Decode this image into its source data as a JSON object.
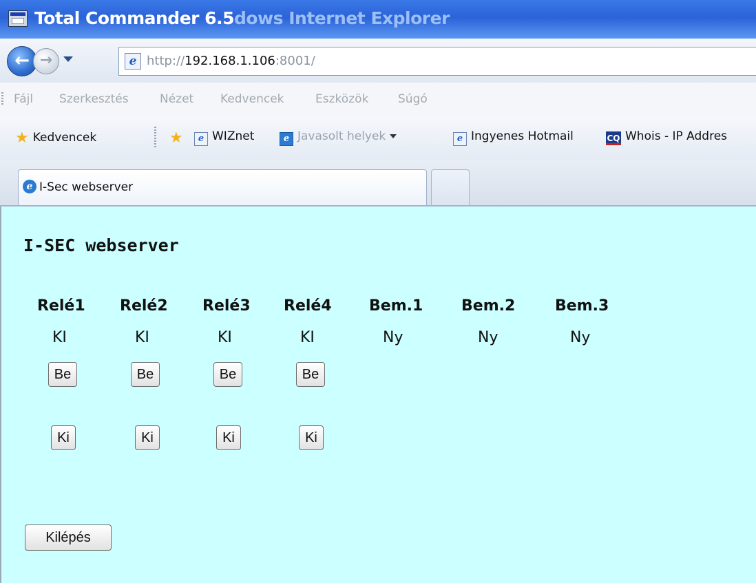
{
  "window": {
    "title_visible": "Total Commander 6.5",
    "title_ghost": "dows Internet Explorer"
  },
  "address": {
    "scheme": "http://",
    "host": "192.168.1.106",
    "rest": ":8001/"
  },
  "menu": {
    "items": [
      "Fájl",
      "Szerkesztés",
      "Nézet",
      "Kedvencek",
      "Eszközök",
      "Súgó"
    ]
  },
  "favorites": {
    "label": "Kedvencek",
    "items": [
      {
        "label": "WIZnet",
        "icon": "ie-page-icon"
      },
      {
        "label": "Javasolt helyek",
        "icon": "ie-logo-icon"
      },
      {
        "label": "Ingyenes Hotmail",
        "icon": "ie-page-icon"
      },
      {
        "label": "Whois - IP Addres",
        "icon": "cq-logo-icon"
      }
    ]
  },
  "tabs": [
    {
      "label": "I-Sec webserver",
      "active": true
    }
  ],
  "page": {
    "title": "I-SEC webserver",
    "columns": [
      {
        "label": "Relé1",
        "state": "KI",
        "on_button": "Be",
        "off_button": "Ki"
      },
      {
        "label": "Relé2",
        "state": "KI",
        "on_button": "Be",
        "off_button": "Ki"
      },
      {
        "label": "Relé3",
        "state": "KI",
        "on_button": "Be",
        "off_button": "Ki"
      },
      {
        "label": "Relé4",
        "state": "KI",
        "on_button": "Be",
        "off_button": "Ki"
      },
      {
        "label": "Bem.1",
        "state": "Ny"
      },
      {
        "label": "Bem.2",
        "state": "Ny"
      },
      {
        "label": "Bem.3",
        "state": "Ny"
      }
    ],
    "exit_button": "Kilépés"
  },
  "colors": {
    "page_background": "#ccffff",
    "titlebar_blue": "#2b63d8"
  }
}
